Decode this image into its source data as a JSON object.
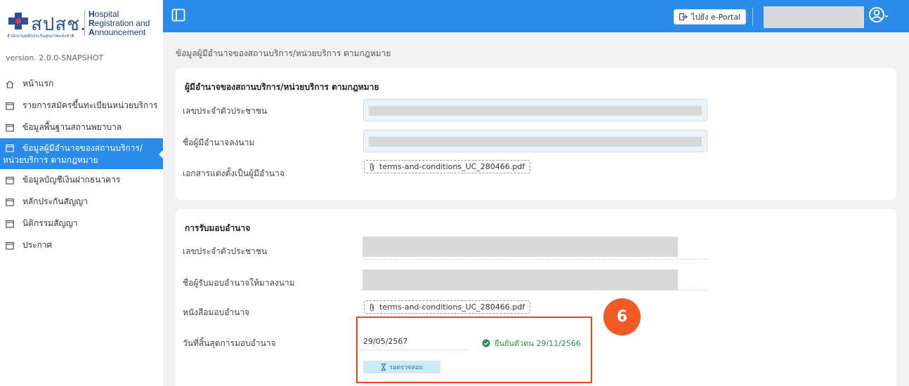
{
  "brand": {
    "logo_thai": "สปสช.",
    "logo_sub": "สำนักงานหลักประกันสุขภาพแห่งชาติ",
    "logo_en_line1_initial": "H",
    "logo_en_line1_rest": "ospital",
    "logo_en_line2_initial": "R",
    "logo_en_line2_rest": "egistration and",
    "logo_en_line3_initial": "A",
    "logo_en_line3_rest": "nnouncement",
    "version": "version. 2.0.0-SNAPSHOT"
  },
  "sidebar": {
    "items": [
      {
        "label": "หน้าแรก",
        "icon": "home-icon"
      },
      {
        "label": "รายการสมัครขึ้นทะเบียนหน่วยบริการ",
        "icon": "calendar-icon"
      },
      {
        "label": "ข้อมูลพื้นฐานสถานพยาบาล",
        "icon": "calendar-icon"
      },
      {
        "label_line1": "ข้อมูลผู้มีอำนาจของสถานบริการ/",
        "label_line2": "หน่วยบริการ ตามกฎหมาย",
        "icon": "calendar-icon",
        "active": true
      },
      {
        "label": "ข้อมูลบัญชีเงินฝากธนาคาร",
        "icon": "calendar-icon"
      },
      {
        "label": "หลักประกันสัญญา",
        "icon": "calendar-icon"
      },
      {
        "label": "นิติกรรมสัญญา",
        "icon": "calendar-icon"
      },
      {
        "label": "ประกาศ",
        "icon": "calendar-icon"
      }
    ]
  },
  "header": {
    "portal_button": "ไปยัง e-Portal",
    "colors": {
      "header_bg": "#2b8be8"
    }
  },
  "breadcrumb": "ข้อมูลผู้มีอำนาจของสถานบริการ/หน่วยบริการ ตามกฎหมาย",
  "authorized_section": {
    "title": "ผู้มีอำนาจของสถานบริการ/หน่วยบริการ ตามกฎหมาย",
    "id_label": "เลขประจำตัวประชาชน",
    "signer_label": "ชื่อผู้มีอำนาจลงนาม",
    "doc_label": "เอกสารแต่งตั้งเป็นผู้มีอำนาจ",
    "doc_file": "terms-and-conditions_UC_280466.pdf"
  },
  "delegation_section": {
    "title": "การรับมอบอำนาจ",
    "id_label": "เลขประจำตัวประชาชน",
    "signer_label": "ชื่อผู้รับมอบอำนาจให้มาลงนาม",
    "letter_label": "หนังสือมอบอำนาจ",
    "letter_file": "terms-and-conditions_UC_280466.pdf",
    "end_date_label": "วันที่สิ้นสุดการมอบอำนาจ",
    "end_date": "29/05/2567",
    "verified_text": "ยืนยันตัวตน 29/11/2566",
    "pending_badge": "รอตรวจสอบ"
  },
  "annotation": {
    "step_number": "6",
    "color": "#e8441c"
  }
}
